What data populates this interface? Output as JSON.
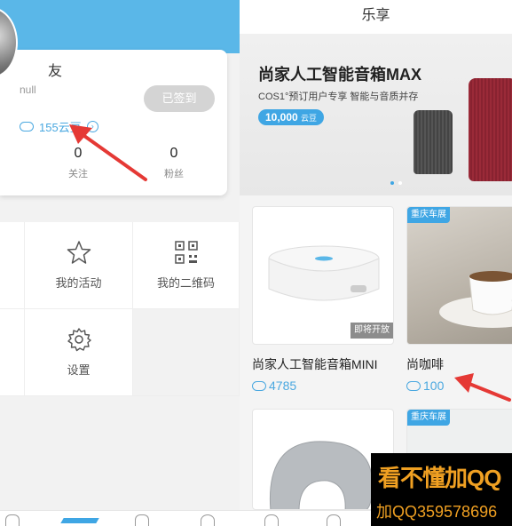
{
  "profile": {
    "name": "友",
    "subtitle": "null",
    "signin_label": "已签到",
    "beans_label": "155云豆",
    "following_count": "0",
    "following_label": "关注",
    "fans_count": "0",
    "fans_label": "粉丝"
  },
  "menu": [
    {
      "label": "我的活动",
      "icon": "star-icon"
    },
    {
      "label": "我的二维码",
      "icon": "qr-code-icon"
    },
    {
      "label": "设置",
      "icon": "gear-icon"
    }
  ],
  "store": {
    "title": "乐享",
    "banner": {
      "title": "尚家人工智能音箱MAX",
      "subtitle": "COS1°预订用户专享  智能与音质并存",
      "price": "10,000",
      "price_unit": "云豆"
    },
    "products": [
      {
        "title": "尚家人工智能音箱MINI",
        "price": "4785",
        "badge": "即将开放"
      },
      {
        "title": "尚咖啡",
        "price": "100",
        "tag": "重庆车展"
      },
      {
        "tag": "重庆车展"
      }
    ]
  },
  "watermark": {
    "line1": "看不懂加QQ",
    "line2": "加QQ359578696"
  },
  "colors": {
    "accent": "#4aa8e0",
    "header": "#5ab7e8",
    "arrow": "#e53935",
    "watermark_text": "#f0a022"
  }
}
